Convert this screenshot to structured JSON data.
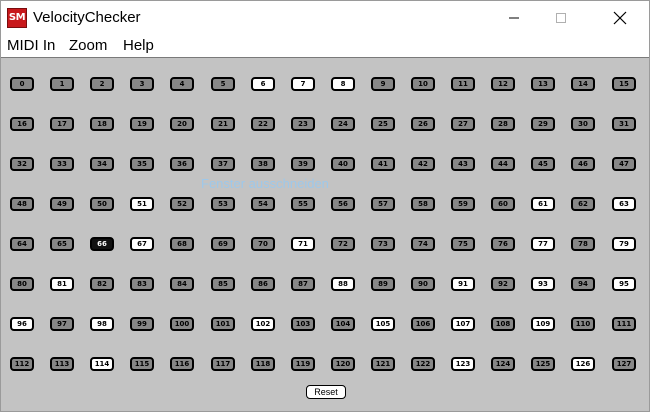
{
  "window": {
    "title": "VelocityChecker",
    "icon_text": "SM",
    "icon_color": "#c8181b"
  },
  "menu": [
    "MIDI In",
    "Zoom",
    "Help"
  ],
  "overlay_text": "Fenster ausschneiden",
  "colors": {
    "inactive": "#878787",
    "active": "#ffffff",
    "selected": "#111111",
    "background": "#c3c3c3"
  },
  "velocity_keys": {
    "first": 0,
    "last": 127,
    "columns": 16,
    "active": [
      6,
      7,
      8,
      51,
      61,
      63,
      67,
      71,
      77,
      79,
      81,
      88,
      91,
      93,
      95,
      96,
      98,
      102,
      105,
      107,
      109,
      114,
      123,
      126
    ],
    "selected": 66
  },
  "reset_label": "Reset"
}
